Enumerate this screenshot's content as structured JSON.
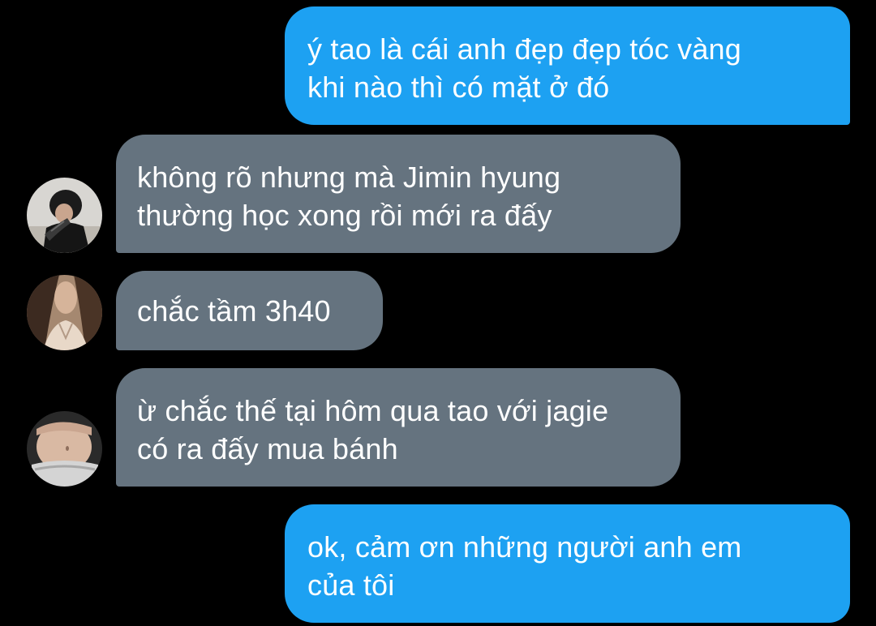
{
  "messages": [
    {
      "direction": "outgoing",
      "lines": [
        "ý tao là cái anh đẹp đẹp tóc vàng",
        "khi nào thì có mặt ở đó"
      ]
    },
    {
      "direction": "incoming",
      "avatar": "avatar-boy-tattoo",
      "lines": [
        "không rõ nhưng mà Jimin hyung",
        "thường học xong rồi mới ra đấy"
      ]
    },
    {
      "direction": "incoming",
      "avatar": "avatar-girl-hair",
      "lines": [
        "chắc tầm 3h40"
      ]
    },
    {
      "direction": "incoming",
      "avatar": "avatar-torso",
      "lines": [
        "ừ chắc thế tại hôm qua tao với jagie",
        "có ra đấy mua bánh"
      ]
    },
    {
      "direction": "outgoing",
      "lines": [
        "ok, cảm ơn những người anh em",
        "của tôi"
      ]
    }
  ],
  "colors": {
    "background": "#000000",
    "outgoing_bubble": "#1da1f2",
    "incoming_bubble": "#65737f",
    "text": "#ffffff"
  }
}
